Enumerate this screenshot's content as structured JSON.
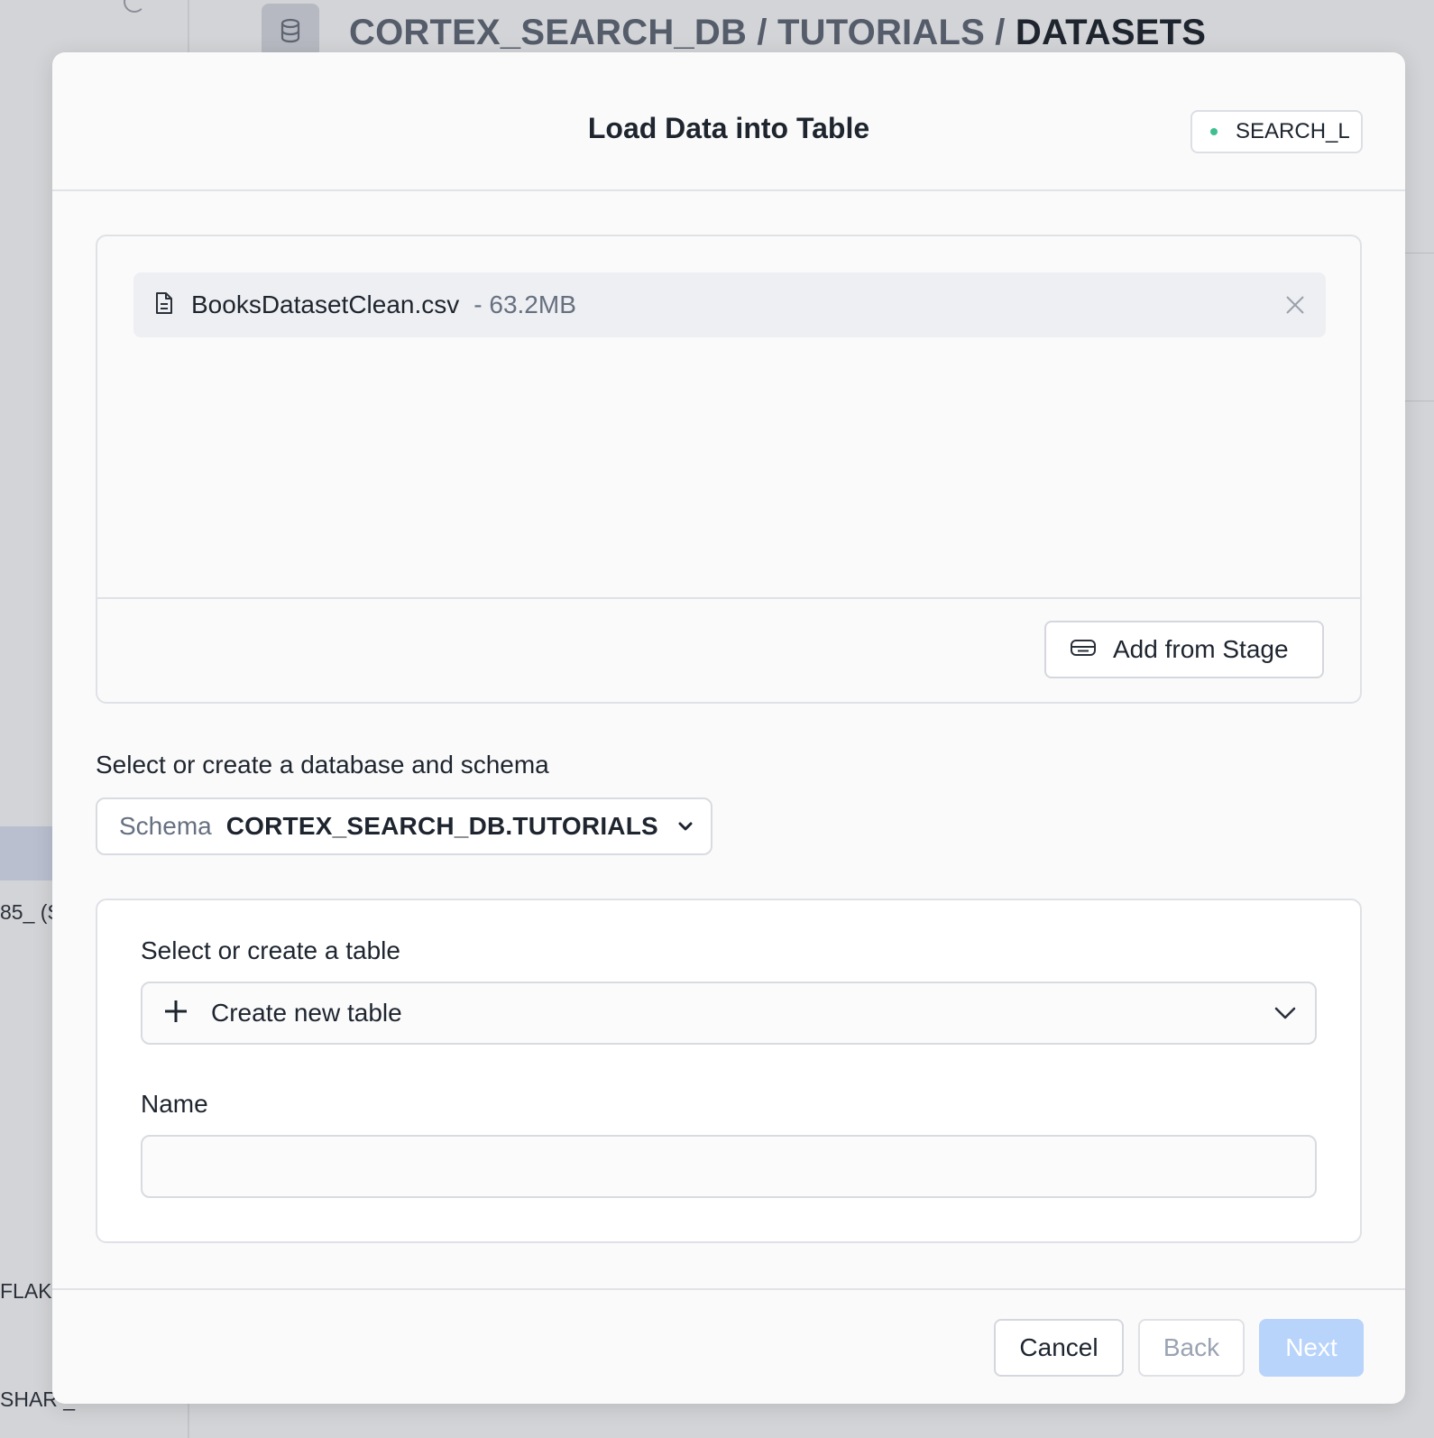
{
  "background": {
    "breadcrumb": {
      "part1": "CORTEX_SEARCH_DB /",
      "part2": "TUTORIALS /",
      "current": "DATASETS"
    },
    "sidebar_rows": [
      "85_ (S",
      "FLAKE",
      "SHAR _"
    ]
  },
  "modal": {
    "title": "Load Data into Table",
    "warehouse": {
      "name": "SEARCH_L",
      "status_color": "#3fbf8f"
    },
    "file": {
      "icon": "file-icon",
      "name": "BooksDatasetClean.csv",
      "size": "- 63.2MB"
    },
    "add_from_stage_label": "Add from Stage",
    "schema_section": {
      "label": "Select or create a database and schema",
      "select_label": "Schema",
      "select_value": "CORTEX_SEARCH_DB.TUTORIALS"
    },
    "table_section": {
      "label": "Select or create a table",
      "select_value": "Create new table",
      "name_label": "Name",
      "name_value": ""
    },
    "footer": {
      "cancel_label": "Cancel",
      "back_label": "Back",
      "next_label": "Next"
    }
  },
  "colors": {
    "accent_disabled": "#b8d4fb",
    "text_primary": "#1e252f",
    "text_muted": "#667080"
  }
}
